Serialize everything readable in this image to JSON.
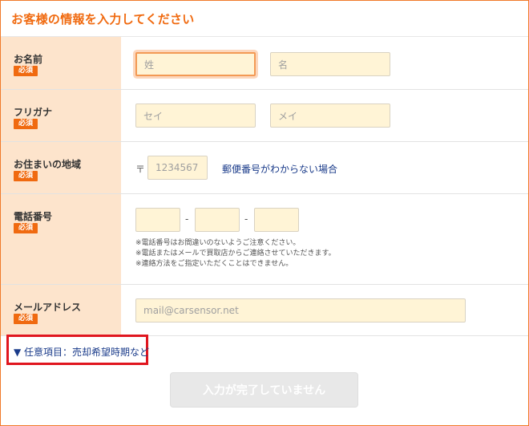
{
  "form": {
    "title": "お客様の情報を入力してください",
    "required_badge": "必須",
    "name": {
      "label": "お名前",
      "last_placeholder": "姓",
      "first_placeholder": "名"
    },
    "furigana": {
      "label": "フリガナ",
      "last_placeholder": "セイ",
      "first_placeholder": "メイ"
    },
    "address": {
      "label": "お住まいの地域",
      "postal_mark": "〒",
      "postal_placeholder": "1234567",
      "unknown_link": "郵便番号がわからない場合"
    },
    "phone": {
      "label": "電話番号",
      "separator": "-",
      "notes": [
        "※電話番号はお間違いのないようご注意ください。",
        "※電話またはメールで買取店からご連絡させていただきます。",
        "※連絡方法をご指定いただくことはできません。"
      ]
    },
    "email": {
      "label": "メールアドレス",
      "placeholder": "mail@carsensor.net"
    },
    "optional_toggle": "▼ 任意項目：売却希望時期など",
    "submit_label": "入力が完了していません"
  }
}
